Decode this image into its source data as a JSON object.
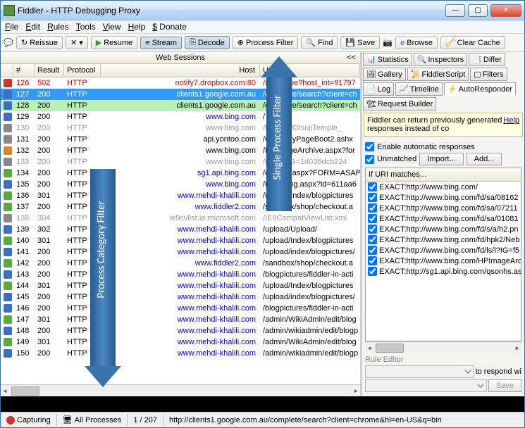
{
  "window": {
    "title": "Fiddler - HTTP Debugging Proxy"
  },
  "menu": {
    "file": "File",
    "edit": "Edit",
    "rules": "Rules",
    "tools": "Tools",
    "view": "View",
    "help": "Help",
    "donate": "$ Donate"
  },
  "toolbar": {
    "reissue": "Reissue",
    "resume": "Resume",
    "stream": "Stream",
    "decode": "Decode",
    "process_filter": "Process Filter",
    "find": "Find",
    "save": "Save",
    "browse": "Browse",
    "clear_cache": "Clear Cache"
  },
  "sessions": {
    "header": "Web Sessions",
    "collapse": "<<",
    "columns": {
      "num": "#",
      "result": "Result",
      "protocol": "Protocol",
      "host": "Host",
      "url": "URL"
    },
    "rows": [
      {
        "n": "126",
        "r": "502",
        "p": "HTTP",
        "h": "notify7.dropbox.com:80",
        "u": "/subscribe?host_int=91797",
        "style": "red",
        "ic": "red"
      },
      {
        "n": "127",
        "r": "200",
        "p": "HTTP",
        "h": "clients1.google.com.au",
        "u": "/complete/search?client=ch",
        "style": "sel",
        "ic": "blue"
      },
      {
        "n": "128",
        "r": "200",
        "p": "HTTP",
        "h": "clients1.google.com.au",
        "u": "/complete/search?client=ch",
        "style": "greenbg",
        "ic": "blue"
      },
      {
        "n": "129",
        "r": "200",
        "p": "HTTP",
        "h": "www.bing.com",
        "u": "/",
        "style": "",
        "hl": true,
        "ic": "blue"
      },
      {
        "n": "130",
        "r": "200",
        "p": "HTTP",
        "h": "www.bing.com",
        "u": "/fd/hpk2/OtsujiTemple_",
        "style": "grey",
        "ic": "grey"
      },
      {
        "n": "131",
        "r": "200",
        "p": "HTTP",
        "h": "api.yontoo.com",
        "u": "/GetYBuyPageBoot2.ashx",
        "style": "",
        "ic": "grey"
      },
      {
        "n": "132",
        "r": "200",
        "p": "HTTP",
        "h": "www.bing.com",
        "u": "/HPImageArchive.aspx?for",
        "style": "",
        "ic": "orange"
      },
      {
        "n": "133",
        "r": "200",
        "p": "HTTP",
        "h": "www.bing.com",
        "u": "/fd/ls/l?IG=1d036dcb224",
        "style": "grey",
        "ic": "grey"
      },
      {
        "n": "134",
        "r": "200",
        "p": "HTTP",
        "h": "sg1.api.bing.com",
        "u": "/qsonhs.aspx?FORM=ASAP",
        "style": "",
        "hl": true,
        "ic": "green"
      },
      {
        "n": "135",
        "r": "200",
        "p": "HTTP",
        "h": "www.bing.com",
        "u": "/LoadBing.aspx?id=611aa6",
        "style": "",
        "hl": true,
        "ic": "blue"
      },
      {
        "n": "136",
        "r": "301",
        "p": "HTTP",
        "h": "www.mehdi-khalili.com",
        "u": "/upload/Index/blogpictures",
        "style": "",
        "hl": true,
        "ic": "green"
      },
      {
        "n": "137",
        "r": "200",
        "p": "HTTP",
        "h": "www.fiddler2.com",
        "u": "/sandbox/shop/checkout.a",
        "style": "",
        "hl": true,
        "ic": "green"
      },
      {
        "n": "138",
        "r": "304",
        "p": "HTTP",
        "h": "ie9cvlist.ie.microsoft.com",
        "u": "/IE9CompatViewList.xml",
        "style": "grey",
        "ic": "grey"
      },
      {
        "n": "139",
        "r": "302",
        "p": "HTTP",
        "h": "www.mehdi-khalili.com",
        "u": "/upload/Upload/",
        "style": "",
        "hl": true,
        "ic": "blue"
      },
      {
        "n": "140",
        "r": "301",
        "p": "HTTP",
        "h": "www.mehdi-khalili.com",
        "u": "/upload/Index/blogpictures",
        "style": "",
        "hl": true,
        "ic": "green"
      },
      {
        "n": "141",
        "r": "200",
        "p": "HTTP",
        "h": "www.mehdi-khalili.com",
        "u": "/upload/index/blogpictures/",
        "style": "",
        "hl": true,
        "ic": "blue"
      },
      {
        "n": "142",
        "r": "200",
        "p": "HTTP",
        "h": "www.fiddler2.com",
        "u": "/sandbox/shop/checkout.a",
        "style": "",
        "hl": true,
        "ic": "green"
      },
      {
        "n": "143",
        "r": "200",
        "p": "HTTP",
        "h": "www.mehdi-khalili.com",
        "u": "/blogpictures/fiddler-in-acti",
        "style": "",
        "hl": true,
        "ic": "blue"
      },
      {
        "n": "144",
        "r": "301",
        "p": "HTTP",
        "h": "www.mehdi-khalili.com",
        "u": "/upload/Index/blogpictures",
        "style": "",
        "hl": true,
        "ic": "green"
      },
      {
        "n": "145",
        "r": "200",
        "p": "HTTP",
        "h": "www.mehdi-khalili.com",
        "u": "/upload/index/blogpictures/",
        "style": "",
        "hl": true,
        "ic": "blue"
      },
      {
        "n": "146",
        "r": "200",
        "p": "HTTP",
        "h": "www.mehdi-khalili.com",
        "u": "/blogpictures/fiddler-in-acti",
        "style": "",
        "hl": true,
        "ic": "blue"
      },
      {
        "n": "147",
        "r": "301",
        "p": "HTTP",
        "h": "www.mehdi-khalili.com",
        "u": "/admin/WikiAdmin/edit/blog",
        "style": "",
        "hl": true,
        "ic": "green"
      },
      {
        "n": "148",
        "r": "200",
        "p": "HTTP",
        "h": "www.mehdi-khalili.com",
        "u": "/admin/wikiadmin/edit/blogp",
        "style": "",
        "hl": true,
        "ic": "blue"
      },
      {
        "n": "149",
        "r": "301",
        "p": "HTTP",
        "h": "www.mehdi-khalili.com",
        "u": "/admin/WikiAdmin/edit/blog",
        "style": "",
        "hl": true,
        "ic": "green"
      },
      {
        "n": "150",
        "r": "200",
        "p": "HTTP",
        "h": "www.mehdi-khalili.com",
        "u": "/admin/wikiadmin/edit/blogp",
        "style": "",
        "hl": true,
        "ic": "blue"
      }
    ]
  },
  "status": {
    "capturing": "Capturing",
    "processes": "All Processes",
    "count": "1 / 207",
    "url": "http://clients1.google.com.au/complete/search?client=chrome&hl=en-US&q=bin"
  },
  "right": {
    "tabs": {
      "statistics": "Statistics",
      "inspectors": "Inspectors",
      "differ": "Differ",
      "gallery": "Gallery",
      "fiddlerscript": "FiddlerScript",
      "filters": "Filters",
      "log": "Log",
      "timeline": "Timeline",
      "autoresponder": "AutoResponder",
      "requestbuilder": "Request Builder"
    },
    "info": {
      "text": "Fiddler can return previously generated responses instead of co",
      "help": "Help"
    },
    "enable": "Enable automatic responses",
    "unmatched": "Unmatched",
    "import": "Import...",
    "add": "Add...",
    "rules_header": "If URI matches...",
    "rules": [
      "EXACT:http://www.bing.com/",
      "EXACT:http://www.bing.com/fd/sa/08162",
      "EXACT:http://www.bing.com/fd/sa/07211",
      "EXACT:http://www.bing.com/fd/sa/01081",
      "EXACT:http://www.bing.com/fd/s/a/h2.pn",
      "EXACT:http://www.bing.com/fd/hpk2/Neb",
      "EXACT:http://www.bing.com/fd/ls/l?IG=f5",
      "EXACT:http://www.bing.com/HPImageArc",
      "EXACT:http://sg1.api.bing.com/qsonhs.as"
    ],
    "editor": {
      "respond": "to respond wi",
      "save": "Save",
      "label": "Rule Editor"
    }
  },
  "annotations": {
    "a1": "Single Process Filter",
    "a2": "Process Category Filter"
  }
}
